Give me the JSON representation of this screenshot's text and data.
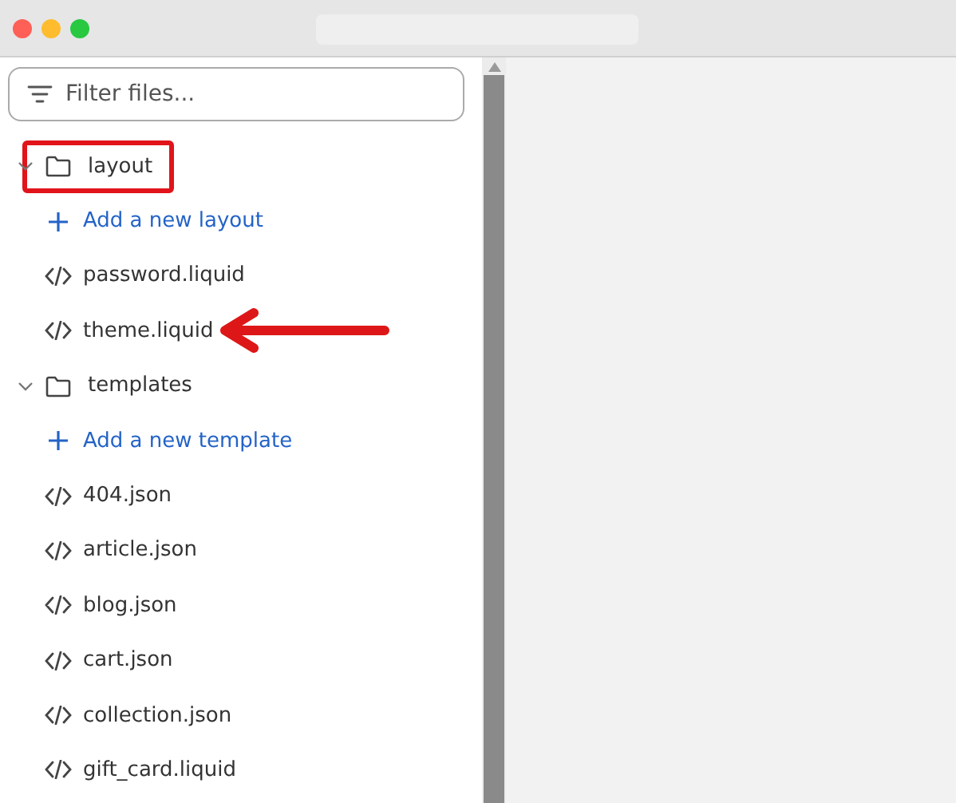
{
  "window": {
    "title_field": true
  },
  "filter": {
    "placeholder": "Filter files..."
  },
  "tree": [
    {
      "kind": "folder",
      "name": "layout",
      "expanded": true,
      "highlighted": true,
      "children": [
        {
          "kind": "add",
          "name": "Add a new layout"
        },
        {
          "kind": "file",
          "name": "password.liquid"
        },
        {
          "kind": "file",
          "name": "theme.liquid",
          "arrow": true
        }
      ]
    },
    {
      "kind": "folder",
      "name": "templates",
      "expanded": true,
      "children": [
        {
          "kind": "add",
          "name": "Add a new template"
        },
        {
          "kind": "file",
          "name": "404.json"
        },
        {
          "kind": "file",
          "name": "article.json"
        },
        {
          "kind": "file",
          "name": "blog.json"
        },
        {
          "kind": "file",
          "name": "cart.json"
        },
        {
          "kind": "file",
          "name": "collection.json"
        },
        {
          "kind": "file",
          "name": "gift_card.liquid"
        }
      ]
    }
  ]
}
